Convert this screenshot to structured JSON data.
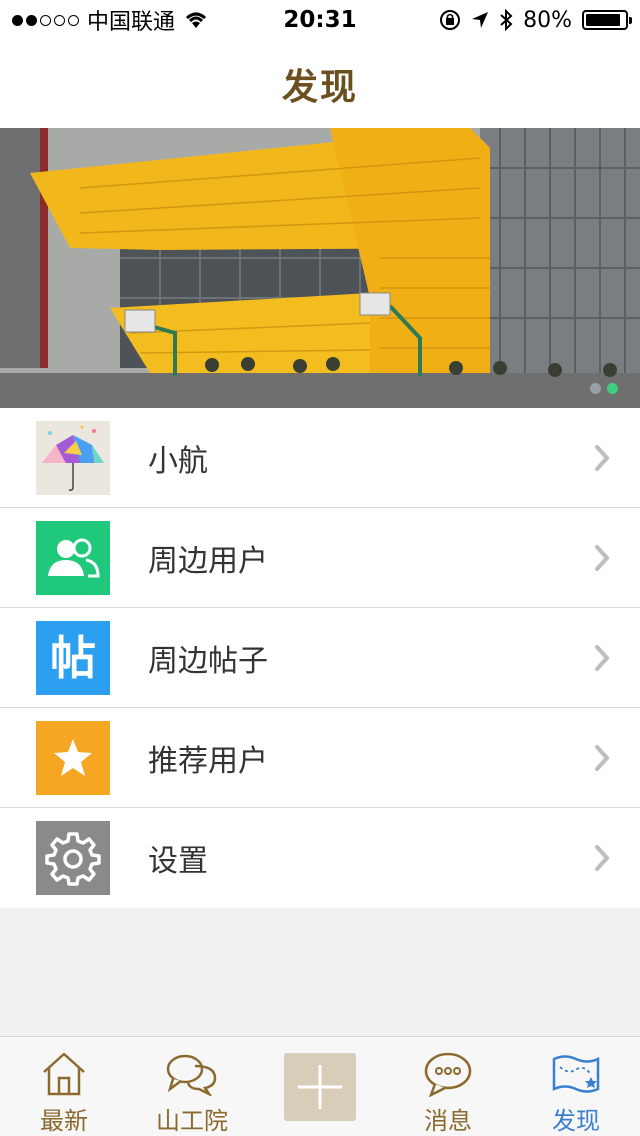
{
  "status_bar": {
    "carrier": "中国联通",
    "time": "20:31",
    "battery": "80%"
  },
  "nav": {
    "title": "发现"
  },
  "banner": {
    "page_count": 2,
    "active_page": 2
  },
  "menu": {
    "items": [
      {
        "label": "小航",
        "icon": "umbrella-thumbnail-icon"
      },
      {
        "label": "周边用户",
        "icon": "nearby-users-icon",
        "color": "#1fc87a"
      },
      {
        "label": "周边帖子",
        "icon": "nearby-posts-icon",
        "color": "#2c9ff0"
      },
      {
        "label": "推荐用户",
        "icon": "star-icon",
        "color": "#f5a623"
      },
      {
        "label": "设置",
        "icon": "gear-icon",
        "color": "#8c8a88"
      }
    ]
  },
  "tabs": [
    {
      "label": "最新",
      "icon": "home-icon"
    },
    {
      "label": "山工院",
      "icon": "chat-bubbles-icon"
    },
    {
      "label": "",
      "icon": "plus-icon"
    },
    {
      "label": "消息",
      "icon": "message-icon"
    },
    {
      "label": "发现",
      "icon": "map-icon",
      "active": true
    }
  ],
  "icon_glyphs": {
    "posts": "帖"
  }
}
